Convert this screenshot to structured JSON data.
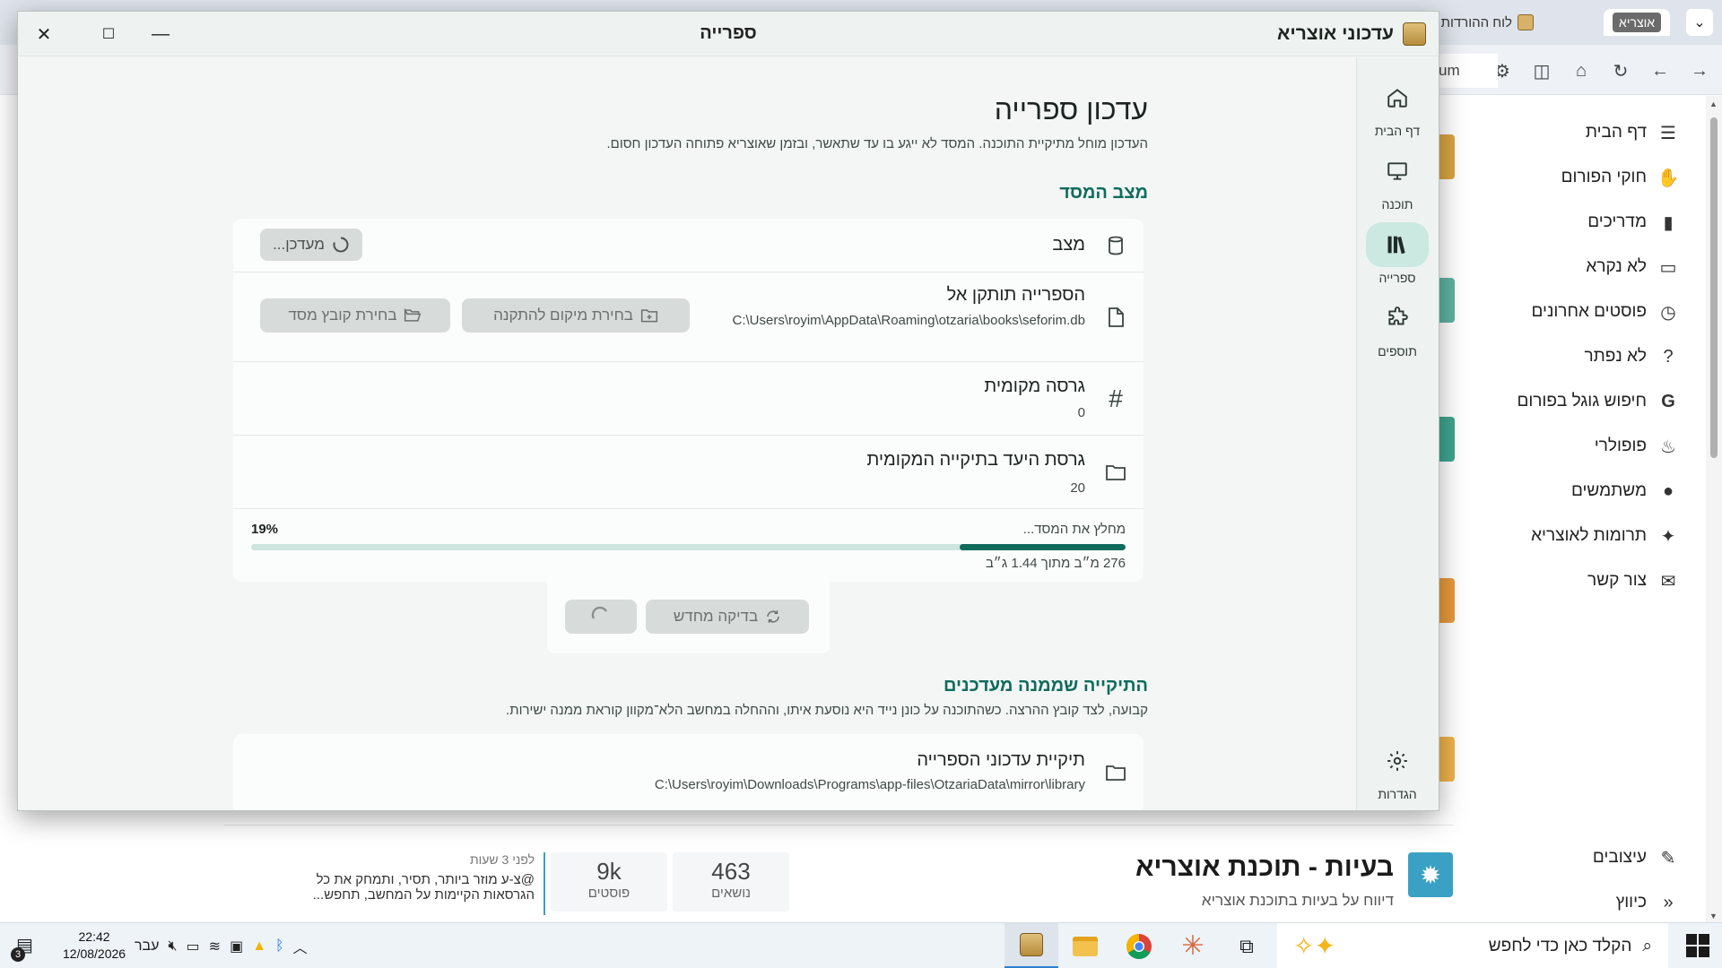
{
  "browser": {
    "tab_active_tag": "אוצריא",
    "tab_active_title": "",
    "tab_other_title": "לוח ההורדות של אוצריא",
    "url_fragment": "um"
  },
  "forum_sidebar": {
    "items": [
      {
        "label": "דף הבית",
        "icon": "menu-icon"
      },
      {
        "label": "חוקי הפורום",
        "icon": "hand-icon"
      },
      {
        "label": "מדריכים",
        "icon": "book-icon"
      },
      {
        "label": "לא נקרא",
        "icon": "inbox-icon"
      },
      {
        "label": "פוסטים אחרונים",
        "icon": "clock-icon"
      },
      {
        "label": "לא נפתר",
        "icon": "question-icon"
      },
      {
        "label": "חיפוש גוגל בפורום",
        "icon": "google-icon"
      },
      {
        "label": "פופולרי",
        "icon": "fire-icon"
      },
      {
        "label": "משתמשים",
        "icon": "user-icon"
      },
      {
        "label": "תרומות לאוצריא",
        "icon": "handshake-icon"
      },
      {
        "label": "צור קשר",
        "icon": "chat-icon"
      }
    ],
    "bottom_items": [
      {
        "label": "עיצובים",
        "icon": "brush-icon"
      },
      {
        "label": "כיווץ",
        "icon": "collapse-icon"
      }
    ]
  },
  "forum_category": {
    "title": "בעיות - תוכנת אוצריא",
    "subtitle": "דיווח על בעיות בתוכנת אוצריא",
    "topics_count": "463",
    "topics_label": "נושאים",
    "posts_count": "9k",
    "posts_label": "פוסטים",
    "last_post_time": "לפני 3 שעות",
    "last_post_text_line1": "@צ-ע מוזר ביותר, תסיר, ותמחק את כל",
    "last_post_text_line2": "הגרסאות הקיימות על המחשב, תחפש..."
  },
  "app": {
    "name": "עדכוני אוצריא",
    "window_title": "ספרייה",
    "nav": [
      {
        "label": "דף הבית",
        "icon": "home-icon",
        "active": false
      },
      {
        "label": "תוכנה",
        "icon": "monitor-icon",
        "active": false
      },
      {
        "label": "ספרייה",
        "icon": "library-icon",
        "active": true
      },
      {
        "label": "תוספים",
        "icon": "puzzle-icon",
        "active": false
      }
    ],
    "settings_label": "הגדרות",
    "page": {
      "title": "עדכון ספרייה",
      "subtitle": "העדכון מוחל מתיקיית התוכנה. המסד לא ייגע בו עד שתאשר, ובזמן שאוצריא פתוחה העדכון חסום.",
      "db_section_title": "מצב המסד",
      "status_label": "מצב",
      "status_button": "מעדכן...",
      "install_label": "הספרייה תותקן אל",
      "install_path": "C:\\Users\\royim\\AppData\\Roaming\\otzaria\\books\\seforim.db",
      "choose_location_button": "בחירת מיקום להתקנה",
      "choose_file_button": "בחירת קובץ מסד",
      "local_version_label": "גרסה מקומית",
      "local_version_value": "0",
      "target_version_label": "גרסת היעד בתיקייה המקומית",
      "target_version_value": "20",
      "progress_label": "מחלץ את המסד...",
      "progress_percent_text": "19%",
      "progress_fraction": 0.19,
      "progress_size": "276 מ״ב מתוך 1.44 ג״ב",
      "recheck_button": "בדיקה מחדש",
      "folder_section_title": "התיקייה שממנה מעדכנים",
      "folder_section_subtitle": "קבועה, לצד קובץ ההרצה. כשהתוכנה על כונן נייד היא נוסעת איתו, וההחלה במחשב הלא־מקוון קוראת ממנה ישירות.",
      "folder_label": "תיקיית עדכוני הספרייה",
      "folder_path": "C:\\Users\\royim\\Downloads\\Programs\\app-files\\OtzariaData\\mirror\\library"
    }
  },
  "taskbar": {
    "search_placeholder": "הקלד כאן כדי לחפש",
    "language": "עבר",
    "time": "22:42",
    "date": "12/08/2026",
    "notification_count": "3"
  },
  "colors": {
    "accent": "#0f6b5c",
    "nav_active": "#cbe8e1",
    "progress_track": "#cde5de",
    "forum_category": "#3aa1c4"
  }
}
